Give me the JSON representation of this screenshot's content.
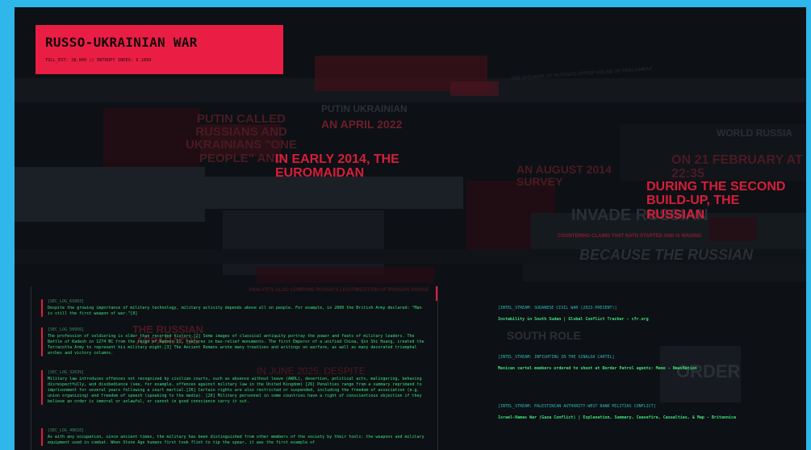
{
  "header": {
    "title": "RUSSO-UKRAINIAN WAR",
    "subtitle": "TOLL_EST: 38,000 // ENTROPY INDEX: 0.1899"
  },
  "headlines": {
    "h1": "PUTIN CALLED RUSSIANS AND UKRAINIANS \"ONE PEOPLE\" AND",
    "h2": "AN APRIL 2022",
    "h3": "IN EARLY 2014, THE EUROMAIDAN",
    "h4": "ON 21 FEBRUARY AT 22:35",
    "h5": "AN AUGUST 2014 SURVEY",
    "h6": "DURING THE SECOND BUILD-UP, THE RUSSIAN",
    "h7": "THE RUSSIAN APPARATUS",
    "h8": "IN JUNE 2025, DESPITE",
    "note1": "THE SPEAKER OF RUSSIA'S UPPER HOUSE OF PARLIAMENT",
    "note2": "COUNTERING CLAIMS THAT NATO STARTED AND IS WAGING",
    "note3": "ANALYSTS ALSO COMPARE RUSSIA'S LEGITIMIZATION OF RUSSIAN INVADE",
    "ghost1": "PUTIN UKRAINIAN",
    "ghost2": "WORLD RUSSIA",
    "ghost3": "INVADE RUSSIAN",
    "ghost4": "BECAUSE THE RUSSIAN",
    "ghost5": "SOUTH ROLE",
    "ghost6": "ORDER"
  },
  "logs": [
    {
      "tag": "[SEC_LOG_61603]",
      "text": "Despite the growing importance of military technology, military activity depends above all on people. For example, in 2000 the British Army declared: \"Man is still the first weapon of war.\"[8]"
    },
    {
      "tag": "[SEC_LOG_50956]",
      "text": "The profession of soldiering is older than recorded history.[2] Some images of classical antiquity portray the power and feats of military leaders. The Battle of Kadesh in 1274 BC from the reign of Ramses II, features in bas-relief monuments. The first Emperor of a unified China, Qin Shi Huang, created the Terracotta Army to represent his military might.[3] The Ancient Romans wrote many treatises and writings on warfare, as well as many decorated triumphal arches and victory columns."
    },
    {
      "tag": "[SEC_LOG_32639]",
      "text": "Military law introduces offences not recognized by civilian courts, such as absence without leave (AWOL), desertion, political acts, malingering, behaving disrespectfully, and disobedience (see, for example, offences against military law in the United Kingdom) [26] Penalties range from a summary reprimand to imprisonment for several years following a court martial.[26] Certain rights are also restricted or suspended, including the freedom of association (e.g. union organizing) and freedom of speech (speaking to the media). [26] Military personnel in some countries have a right of conscientious objection if they believe an order is immoral or unlawful, or cannot in good conscience carry it out."
    },
    {
      "tag": "[SEC_LOG_40610]",
      "text": "As with any occupation, since ancient times, the military has been distinguished from other members of the society by their tools: the weapons and military equipment used in combat. When Stone Age humans first took flint to tip the spear, it was the first example of"
    }
  ],
  "intel": [
    {
      "tag": "[INTEL_STREAM: SUDANESE CIVIL WAR (2023-PRESENT)]",
      "link": "Instability in South Sudan | Global Conflict Tracker - cfr.org"
    },
    {
      "tag": "[INTEL_STREAM: INFIGHTING IN THE SINALOA CARTEL]",
      "link": "Mexican cartel members ordered to shoot at Border Patrol agents: Memo - NewsNation"
    },
    {
      "tag": "[INTEL_STREAM: PALESTINIAN AUTHORITY-WEST BANK MILITIAS CONFLICT]",
      "link": "Israel-Hamas War (Gaza Conflict) | Explanation, Summary, Ceasefire, Casualties, & Map - Britannica"
    }
  ],
  "colors": {
    "accent": "#ea1e44",
    "terminal_green": "#3de07e",
    "cyan": "#2db7b7",
    "frame_bg": "#2fb6ea"
  }
}
